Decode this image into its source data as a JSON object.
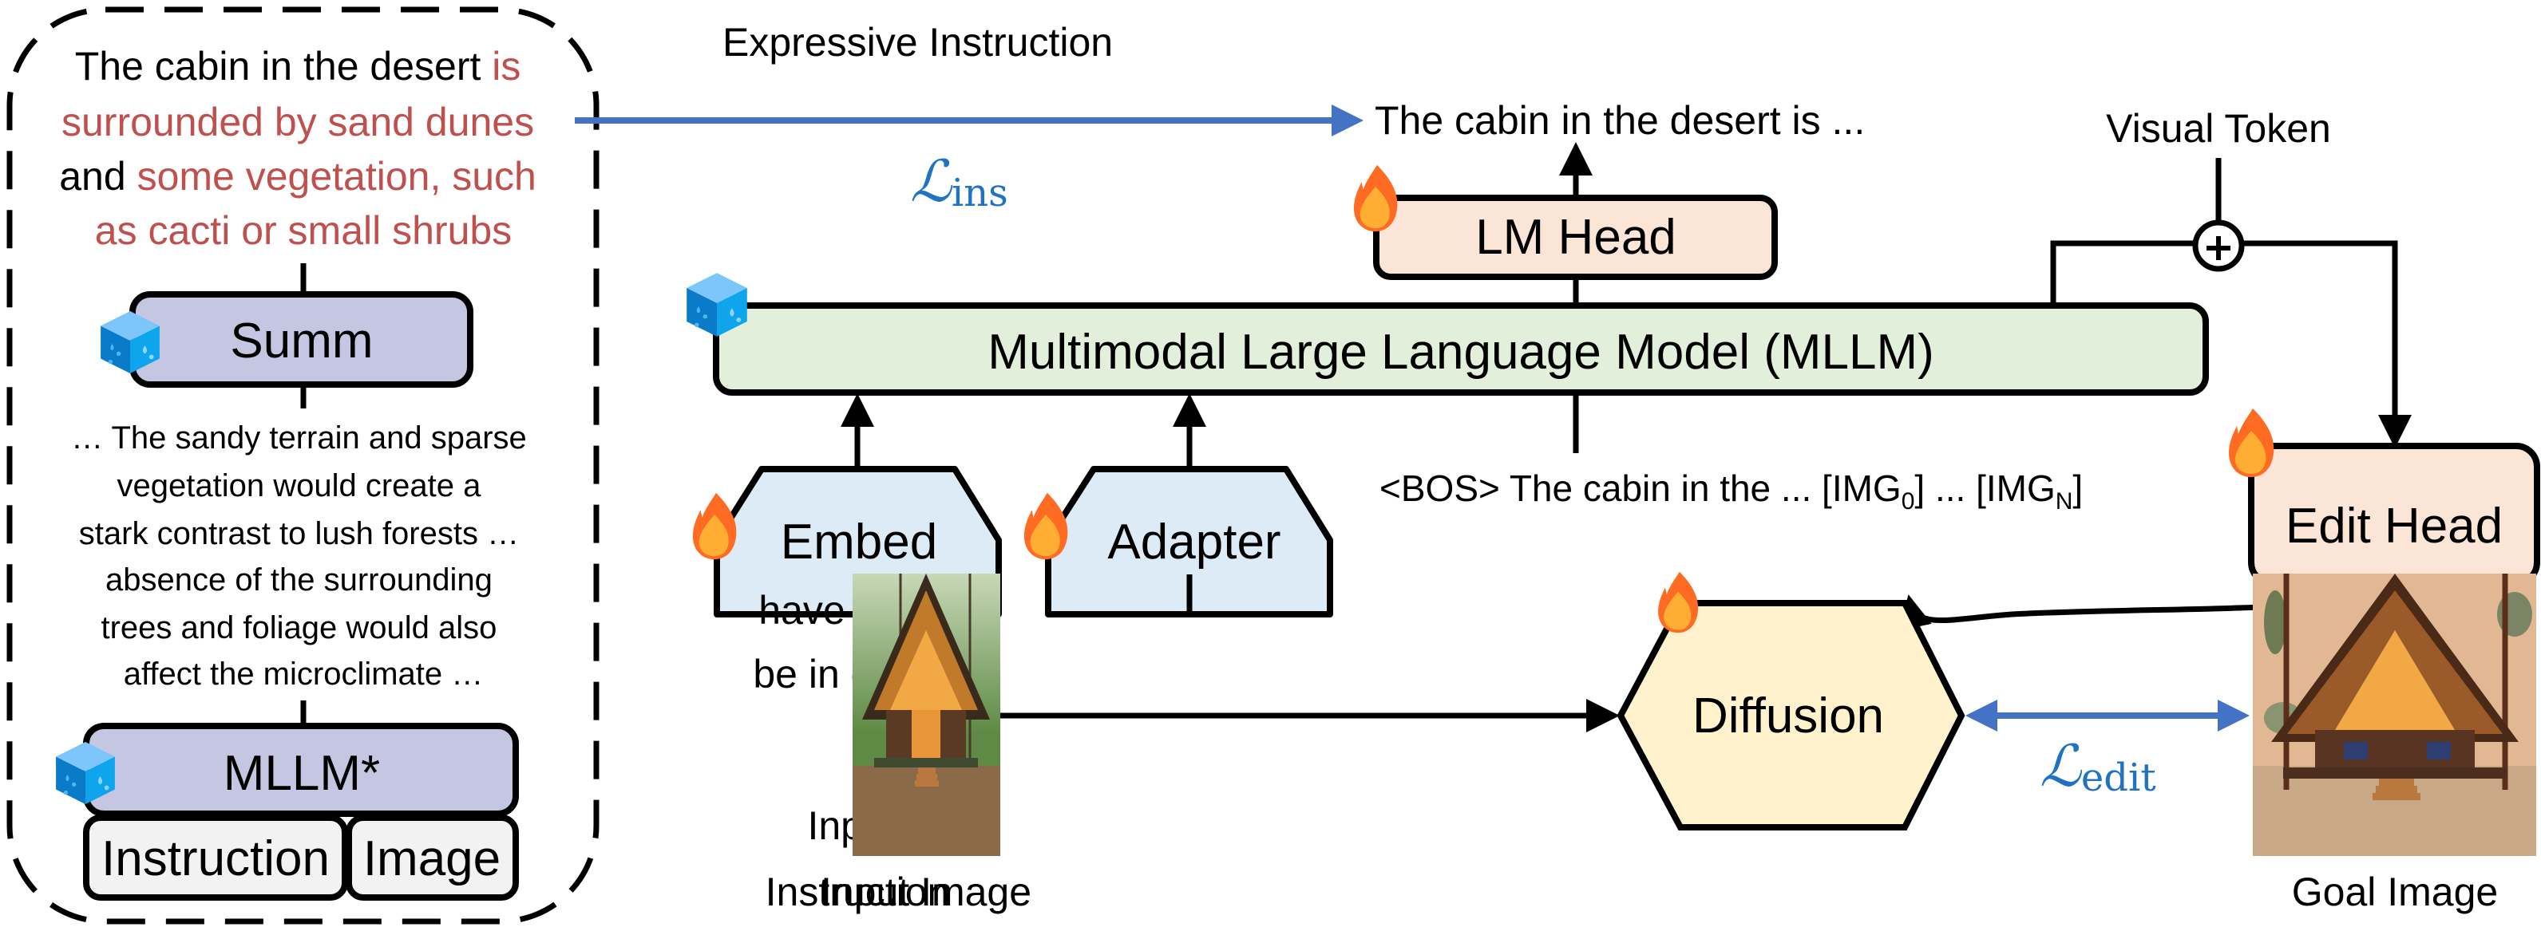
{
  "figure": {
    "expressive_instruction_heading": "Expressive Instruction",
    "left_panel": {
      "expressive_text_lines": [
        [
          {
            "text": "The cabin in the desert ",
            "color": "black"
          },
          {
            "text": "is",
            "color": "red"
          }
        ],
        [
          {
            "text": "surrounded by sand dunes",
            "color": "red"
          }
        ],
        [
          {
            "text": "and ",
            "color": "black"
          },
          {
            "text": "some vegetation, such",
            "color": "red"
          }
        ],
        [
          {
            "text": "as cacti or small shrubs",
            "color": "red"
          }
        ]
      ],
      "summ_label": "Summ",
      "reasoning_text_lines": [
        "… The sandy terrain and sparse",
        "vegetation would create a",
        "stark contrast to lush forests …",
        "absence of the surrounding",
        "trees and foliage would also",
        "affect the microclimate …"
      ],
      "mllm_star_label": "MLLM*",
      "instruction_input_label": "Instruction",
      "image_input_label": "Image"
    },
    "loss_ins": {
      "symbol": "ℒ",
      "subscript": "ins"
    },
    "loss_edit": {
      "symbol": "ℒ",
      "subscript": "edit"
    },
    "lm_output_text": "The cabin in the desert is ...",
    "lm_head_label": "LM Head",
    "visual_token_label": "Visual Token",
    "mllm_label": "Multimodal Large Language Model (MLLM)",
    "embed_label": "Embed",
    "adapter_label": "Adapter",
    "token_sequence": {
      "prefix": "<BOS> The cabin in the ...  [IMG",
      "sub0": "0",
      "middle": "] ... [IMG",
      "subN": "N",
      "suffix": "]"
    },
    "edit_head_label": "Edit Head",
    "input_instruction_text_lines": [
      "have them",
      "be in desert"
    ],
    "input_instruction_caption_lines": [
      "Input",
      "Instruction"
    ],
    "input_image_caption": "Input Image",
    "diffusion_label": "Diffusion",
    "goal_image_caption": "Goal Image",
    "colors": {
      "red_text": "#C0504D",
      "loss_blue": "#1F73C2",
      "arrow_blue": "#4472C4",
      "purple_box": "#C5C6E2",
      "gray_box": "#F2F2F2",
      "green_box": "#E2EFDA",
      "peach_box": "#FBE5D6",
      "light_blue_box": "#DDEBF7",
      "diffusion_fill": "#FFF2CC",
      "fire_outer": "#FF6B22",
      "fire_inner": "#FFAE33",
      "cube_top": "#7CC6FB",
      "cube_left": "#0A7BC8",
      "cube_right": "#0EA5EC"
    },
    "icons": {
      "frozen": "ice-cube-icon",
      "trainable": "fire-icon",
      "sum": "circle-plus-icon"
    }
  }
}
